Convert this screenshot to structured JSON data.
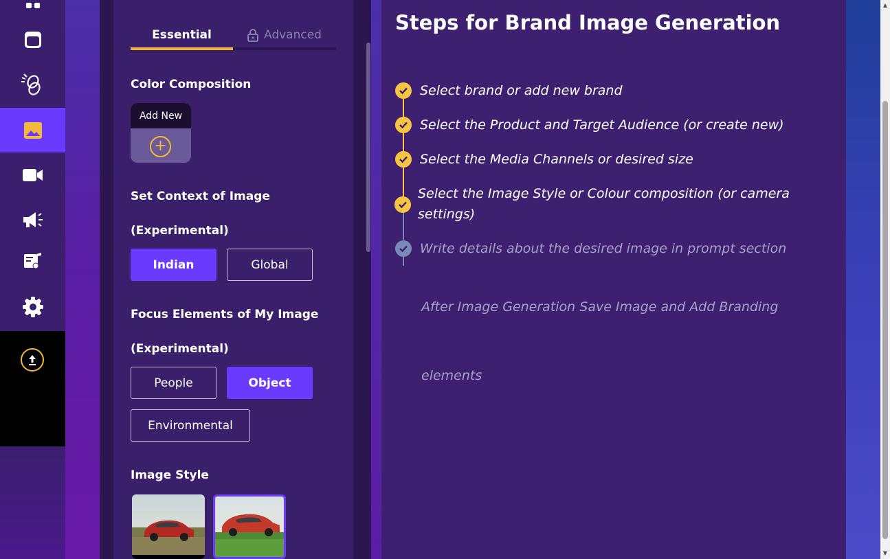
{
  "tabs": {
    "essential": "Essential",
    "advanced": "Advanced"
  },
  "panel": {
    "color_composition": {
      "title": "Color Composition",
      "add_new": "Add New"
    },
    "context": {
      "title": "Set Context of Image",
      "subtitle": "(Experimental)",
      "options": [
        "Indian",
        "Global"
      ],
      "selected": "Indian"
    },
    "focus": {
      "title": "Focus Elements of My Image",
      "subtitle": "(Experimental)",
      "options": [
        "People",
        "Object",
        "Environmental"
      ],
      "selected": "Object"
    },
    "image_style": {
      "title": "Image Style"
    }
  },
  "main": {
    "title": "Steps for Brand Image Generation",
    "steps": [
      {
        "text": "Select brand or add new brand",
        "done": true
      },
      {
        "text": "Select the Product and Target Audience (or create new)",
        "done": true
      },
      {
        "text": "Select the Media Channels or desired size",
        "done": true
      },
      {
        "text": "Select the Image Style or Colour composition (or camera",
        "text2": "settings)",
        "done": true
      },
      {
        "text": "Write details about the desired image in prompt section",
        "done": false
      }
    ],
    "note_line1": "After Image Generation Save Image and Add Branding",
    "note_line2": "elements"
  },
  "colors": {
    "accent": "#6a3bff",
    "check": "#f5c542",
    "panel": "#3a1f6b"
  }
}
